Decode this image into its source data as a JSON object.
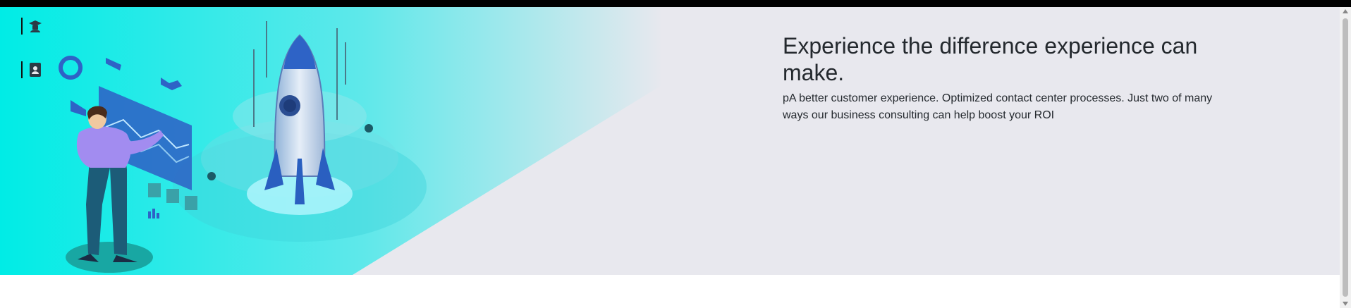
{
  "hero": {
    "headline": "Experience the difference experience can make.",
    "subtext": "pA better customer experience. Optimized contact center processes. Just two of many ways our business consulting can help boost your ROI"
  },
  "side_icons": [
    {
      "name": "graduate-icon"
    },
    {
      "name": "contact-book-icon"
    }
  ],
  "colors": {
    "accent_cyan": "#00e5e5",
    "hero_bg": "#e8e8ee",
    "text": "#24292e"
  }
}
